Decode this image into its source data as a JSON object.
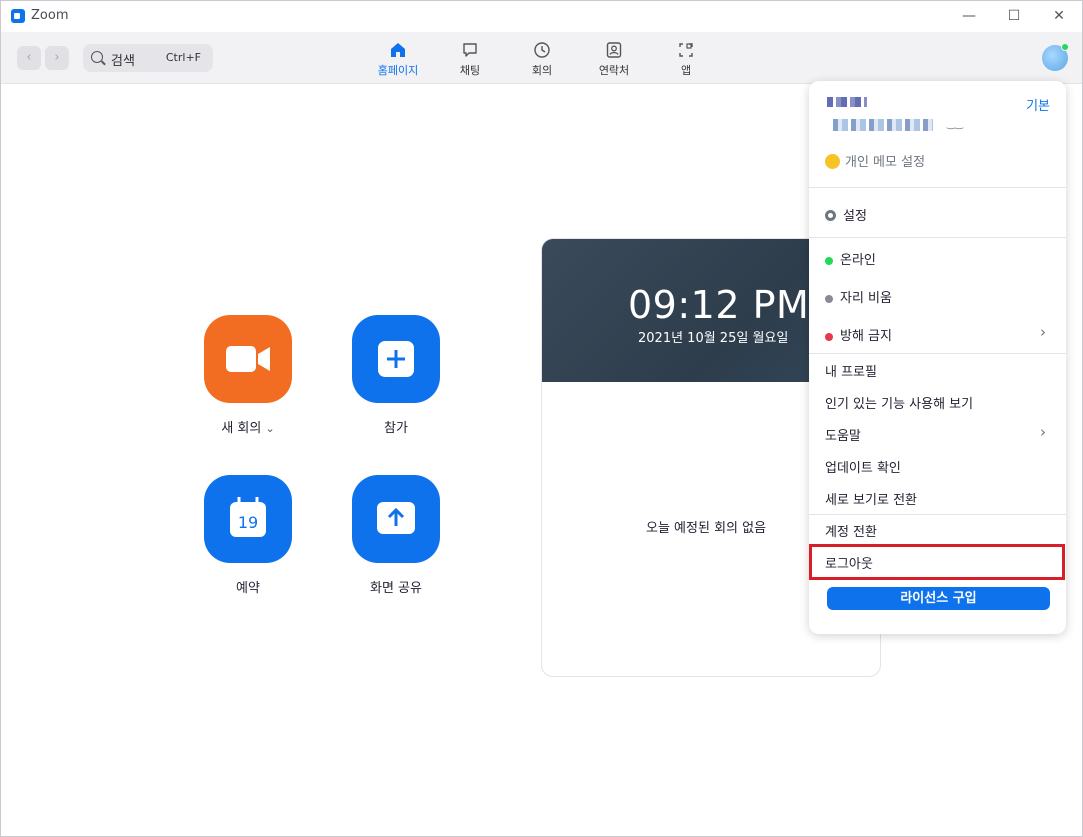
{
  "window": {
    "title": "Zoom",
    "minimize": "—",
    "maximize": "☐",
    "close": "✕"
  },
  "toolbar": {
    "back": "‹",
    "forward": "›",
    "search_label": "검색",
    "search_shortcut": "Ctrl+F",
    "tabs": [
      {
        "label": "홈페이지",
        "icon": "home-icon",
        "active": true
      },
      {
        "label": "채팅",
        "icon": "chat-icon",
        "active": false
      },
      {
        "label": "회의",
        "icon": "clock-icon",
        "active": false
      },
      {
        "label": "연락처",
        "icon": "contacts-icon",
        "active": false
      },
      {
        "label": "앱",
        "icon": "apps-icon",
        "active": false
      }
    ]
  },
  "actions": {
    "new_meeting": "새 회의",
    "new_meeting_caret": "⌄",
    "join": "참가",
    "schedule": "예약",
    "schedule_day": "19",
    "share_screen": "화면 공유"
  },
  "card": {
    "time": "09:12 PM",
    "date": "2021년 10월 25일 월요일",
    "empty_text": "오늘 예정된 회의 없음"
  },
  "menu": {
    "plan": "기본",
    "memo": "개인 메모 설정",
    "settings": "설정",
    "status_online": "온라인",
    "status_away": "자리 비움",
    "status_dnd": "방해 금지",
    "profile": "내 프로필",
    "try_features": "인기 있는 기능 사용해 보기",
    "help": "도움말",
    "check_updates": "업데이트 확인",
    "portrait_view": "세로 보기로 전환",
    "switch_account": "계정 전환",
    "logout": "로그아웃",
    "buy_license": "라이선스 구입",
    "chevron": "›"
  },
  "colors": {
    "accent": "#0e72ed",
    "new_meeting": "#f26d21",
    "highlight": "#d81f27",
    "online": "#23d959",
    "dnd": "#e8384b"
  }
}
